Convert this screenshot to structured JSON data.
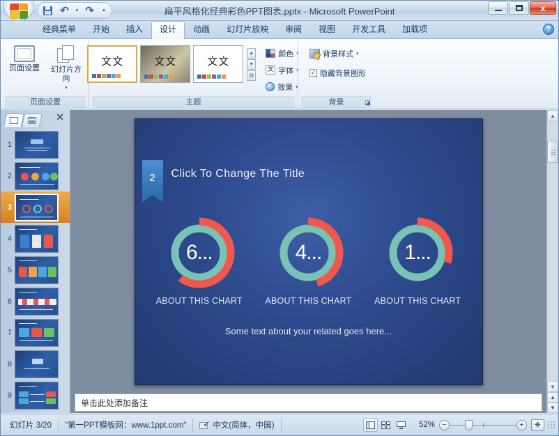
{
  "window": {
    "title": "扁平风格化经典彩色PPT图表.pptx  -  Microsoft PowerPoint",
    "minimize_label": "最小化",
    "maximize_label": "最大化",
    "close_label": "x"
  },
  "quick_access": {
    "save_label": "保存",
    "undo_label": "撤消",
    "undo_caret": "▾",
    "redo_label": "恢复",
    "customize_label": "▾"
  },
  "ribbon_tabs": [
    {
      "label": "经典菜单",
      "active": false
    },
    {
      "label": "开始",
      "active": false
    },
    {
      "label": "插入",
      "active": false
    },
    {
      "label": "设计",
      "active": true
    },
    {
      "label": "动画",
      "active": false
    },
    {
      "label": "幻灯片放映",
      "active": false
    },
    {
      "label": "审阅",
      "active": false
    },
    {
      "label": "视图",
      "active": false
    },
    {
      "label": "开发工具",
      "active": false
    },
    {
      "label": "加载项",
      "active": false
    }
  ],
  "help": {
    "label": "?"
  },
  "ribbon": {
    "page_setup_group": {
      "label": "页面设置",
      "page_setup_button": "页面设置",
      "orientation_button": "幻灯片方向",
      "orientation_caret": "▾"
    },
    "theme_group": {
      "label": "主题",
      "thumb_text": "文文",
      "scroll_up": "▲",
      "scroll_down": "▼",
      "scroll_more": "▤",
      "colors_button": "颜色",
      "colors_caret": "▾",
      "fonts_button": "字体",
      "fonts_glyph": "文",
      "fonts_caret": "▾",
      "effects_button": "效果",
      "effects_caret": "▾"
    },
    "background_group": {
      "label": "背景",
      "bg_styles_button": "背景样式",
      "bg_styles_caret": "▾",
      "hide_bg_checkbox": "隐藏背景图形",
      "hide_bg_checked": "✓",
      "dialog_launcher": "◪"
    }
  },
  "slide_panel": {
    "slides_tab": "幻灯片",
    "outline_tab": "大纲",
    "close": "✕",
    "thumbnails": [
      {
        "number": "1",
        "selected": false
      },
      {
        "number": "2",
        "selected": false
      },
      {
        "number": "3",
        "selected": true
      },
      {
        "number": "4",
        "selected": false
      },
      {
        "number": "5",
        "selected": false
      },
      {
        "number": "6",
        "selected": false
      },
      {
        "number": "7",
        "selected": false
      },
      {
        "number": "8",
        "selected": false
      },
      {
        "number": "9",
        "selected": false
      }
    ]
  },
  "slide": {
    "badge_number": "2",
    "title": "Click To Change The Title",
    "subtitle": "Some text about your  related goes here...",
    "caption_1": "ABOUT THIS CHART",
    "caption_2": "ABOUT THIS CHART",
    "caption_3": "ABOUT THIS CHART"
  },
  "chart_data": {
    "type": "pie",
    "title": "Click To Change The Title",
    "subtitle": "Some text about your  related goes here...",
    "legend": "none",
    "colors": {
      "accent_red": "#f0584e",
      "accent_teal": "#79c3b6",
      "slide_bg": "#2c4a8c"
    },
    "charts": [
      {
        "label": "ABOUT THIS CHART",
        "center_text": "6...",
        "value": 60,
        "segments": [
          {
            "name": "red",
            "value": 60,
            "color": "#f0584e"
          },
          {
            "name": "teal",
            "value": 40,
            "color": "#79c3b6"
          }
        ]
      },
      {
        "label": "ABOUT THIS CHART",
        "center_text": "4...",
        "value": 45,
        "segments": [
          {
            "name": "red",
            "value": 45,
            "color": "#f0584e"
          },
          {
            "name": "teal",
            "value": 55,
            "color": "#79c3b6"
          }
        ]
      },
      {
        "label": "ABOUT THIS CHART",
        "center_text": "1...",
        "value": 30,
        "segments": [
          {
            "name": "red",
            "value": 30,
            "color": "#f0584e"
          },
          {
            "name": "teal",
            "value": 70,
            "color": "#79c3b6"
          }
        ]
      }
    ]
  },
  "notes": {
    "placeholder": "单击此处添加备注"
  },
  "scrollbar": {
    "up": "▲",
    "down": "▼",
    "prev_slide": "▲",
    "next_slide": "▼"
  },
  "status": {
    "slide_counter": "幻灯片 3/20",
    "theme_name": "\"第一PPT模板网：www.1ppt.com\"",
    "language": "中文(简体，中国)",
    "view_normal": "普通视图",
    "view_sorter": "幻灯片浏览",
    "view_show": "幻灯片放映",
    "zoom_level": "52%",
    "zoom_out": "−",
    "zoom_in": "+",
    "fit_window": "✥"
  }
}
